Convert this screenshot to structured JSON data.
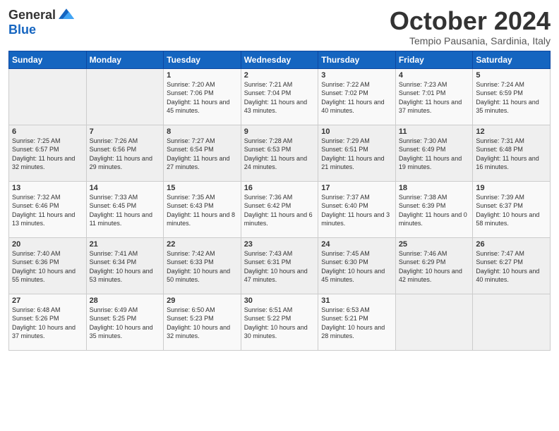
{
  "header": {
    "logo_general": "General",
    "logo_blue": "Blue",
    "title": "October 2024",
    "subtitle": "Tempio Pausania, Sardinia, Italy"
  },
  "days_of_week": [
    "Sunday",
    "Monday",
    "Tuesday",
    "Wednesday",
    "Thursday",
    "Friday",
    "Saturday"
  ],
  "weeks": [
    [
      {
        "day": "",
        "info": ""
      },
      {
        "day": "",
        "info": ""
      },
      {
        "day": "1",
        "info": "Sunrise: 7:20 AM\nSunset: 7:06 PM\nDaylight: 11 hours and 45 minutes."
      },
      {
        "day": "2",
        "info": "Sunrise: 7:21 AM\nSunset: 7:04 PM\nDaylight: 11 hours and 43 minutes."
      },
      {
        "day": "3",
        "info": "Sunrise: 7:22 AM\nSunset: 7:02 PM\nDaylight: 11 hours and 40 minutes."
      },
      {
        "day": "4",
        "info": "Sunrise: 7:23 AM\nSunset: 7:01 PM\nDaylight: 11 hours and 37 minutes."
      },
      {
        "day": "5",
        "info": "Sunrise: 7:24 AM\nSunset: 6:59 PM\nDaylight: 11 hours and 35 minutes."
      }
    ],
    [
      {
        "day": "6",
        "info": "Sunrise: 7:25 AM\nSunset: 6:57 PM\nDaylight: 11 hours and 32 minutes."
      },
      {
        "day": "7",
        "info": "Sunrise: 7:26 AM\nSunset: 6:56 PM\nDaylight: 11 hours and 29 minutes."
      },
      {
        "day": "8",
        "info": "Sunrise: 7:27 AM\nSunset: 6:54 PM\nDaylight: 11 hours and 27 minutes."
      },
      {
        "day": "9",
        "info": "Sunrise: 7:28 AM\nSunset: 6:53 PM\nDaylight: 11 hours and 24 minutes."
      },
      {
        "day": "10",
        "info": "Sunrise: 7:29 AM\nSunset: 6:51 PM\nDaylight: 11 hours and 21 minutes."
      },
      {
        "day": "11",
        "info": "Sunrise: 7:30 AM\nSunset: 6:49 PM\nDaylight: 11 hours and 19 minutes."
      },
      {
        "day": "12",
        "info": "Sunrise: 7:31 AM\nSunset: 6:48 PM\nDaylight: 11 hours and 16 minutes."
      }
    ],
    [
      {
        "day": "13",
        "info": "Sunrise: 7:32 AM\nSunset: 6:46 PM\nDaylight: 11 hours and 13 minutes."
      },
      {
        "day": "14",
        "info": "Sunrise: 7:33 AM\nSunset: 6:45 PM\nDaylight: 11 hours and 11 minutes."
      },
      {
        "day": "15",
        "info": "Sunrise: 7:35 AM\nSunset: 6:43 PM\nDaylight: 11 hours and 8 minutes."
      },
      {
        "day": "16",
        "info": "Sunrise: 7:36 AM\nSunset: 6:42 PM\nDaylight: 11 hours and 6 minutes."
      },
      {
        "day": "17",
        "info": "Sunrise: 7:37 AM\nSunset: 6:40 PM\nDaylight: 11 hours and 3 minutes."
      },
      {
        "day": "18",
        "info": "Sunrise: 7:38 AM\nSunset: 6:39 PM\nDaylight: 11 hours and 0 minutes."
      },
      {
        "day": "19",
        "info": "Sunrise: 7:39 AM\nSunset: 6:37 PM\nDaylight: 10 hours and 58 minutes."
      }
    ],
    [
      {
        "day": "20",
        "info": "Sunrise: 7:40 AM\nSunset: 6:36 PM\nDaylight: 10 hours and 55 minutes."
      },
      {
        "day": "21",
        "info": "Sunrise: 7:41 AM\nSunset: 6:34 PM\nDaylight: 10 hours and 53 minutes."
      },
      {
        "day": "22",
        "info": "Sunrise: 7:42 AM\nSunset: 6:33 PM\nDaylight: 10 hours and 50 minutes."
      },
      {
        "day": "23",
        "info": "Sunrise: 7:43 AM\nSunset: 6:31 PM\nDaylight: 10 hours and 47 minutes."
      },
      {
        "day": "24",
        "info": "Sunrise: 7:45 AM\nSunset: 6:30 PM\nDaylight: 10 hours and 45 minutes."
      },
      {
        "day": "25",
        "info": "Sunrise: 7:46 AM\nSunset: 6:29 PM\nDaylight: 10 hours and 42 minutes."
      },
      {
        "day": "26",
        "info": "Sunrise: 7:47 AM\nSunset: 6:27 PM\nDaylight: 10 hours and 40 minutes."
      }
    ],
    [
      {
        "day": "27",
        "info": "Sunrise: 6:48 AM\nSunset: 5:26 PM\nDaylight: 10 hours and 37 minutes."
      },
      {
        "day": "28",
        "info": "Sunrise: 6:49 AM\nSunset: 5:25 PM\nDaylight: 10 hours and 35 minutes."
      },
      {
        "day": "29",
        "info": "Sunrise: 6:50 AM\nSunset: 5:23 PM\nDaylight: 10 hours and 32 minutes."
      },
      {
        "day": "30",
        "info": "Sunrise: 6:51 AM\nSunset: 5:22 PM\nDaylight: 10 hours and 30 minutes."
      },
      {
        "day": "31",
        "info": "Sunrise: 6:53 AM\nSunset: 5:21 PM\nDaylight: 10 hours and 28 minutes."
      },
      {
        "day": "",
        "info": ""
      },
      {
        "day": "",
        "info": ""
      }
    ]
  ]
}
